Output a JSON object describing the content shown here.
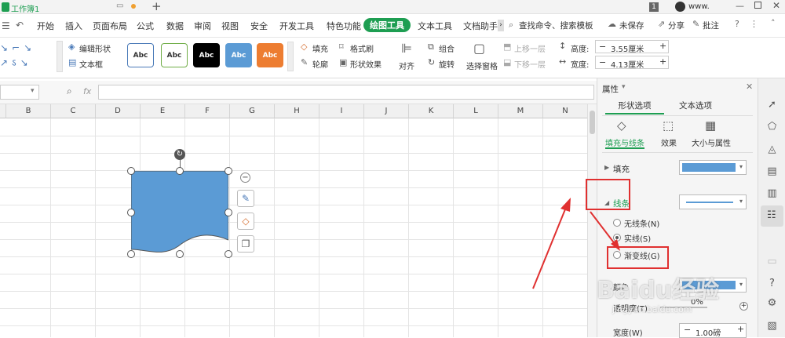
{
  "titlebar": {
    "doc_title": "工作簿1",
    "page_badge": "1",
    "account": "www."
  },
  "menu": {
    "items": [
      "开始",
      "插入",
      "页面布局",
      "公式",
      "数据",
      "审阅",
      "视图",
      "安全",
      "开发工具",
      "特色功能",
      "绘图工具",
      "文本工具",
      "文档助手"
    ],
    "active": "绘图工具",
    "search": "查找命令、搜索模板",
    "unsaved": "未保存",
    "share": "分享",
    "comment": "批注"
  },
  "ribbon": {
    "edit_shape": "编辑形状",
    "textbox": "文本框",
    "styles": [
      "Abc",
      "Abc",
      "Abc",
      "Abc",
      "Abc"
    ],
    "fill": "填充",
    "format_brush": "格式刷",
    "outline": "轮廓",
    "shape_effect": "形状效果",
    "align": "对齐",
    "group": "组合",
    "rotate": "旋转",
    "selection_pane": "选择窗格",
    "bring_forward": "上移一层",
    "send_backward": "下移一层",
    "height_label": "高度:",
    "height_value": "3.55厘米",
    "width_label": "宽度:",
    "width_value": "4.13厘米"
  },
  "formula": {
    "fx": "fx"
  },
  "grid": {
    "columns": [
      "B",
      "C",
      "D",
      "E",
      "F",
      "G",
      "H",
      "I",
      "J",
      "K",
      "L",
      "M",
      "N"
    ]
  },
  "panel": {
    "title": "属性",
    "tabs": [
      "形状选项",
      "文本选项"
    ],
    "subtabs": [
      "填充与线条",
      "效果",
      "大小与属性"
    ],
    "fill_label": "填充",
    "line_label": "线条",
    "options": [
      "无线条(N)",
      "实线(S)",
      "渐变线(G)"
    ],
    "selected_option": "实线(S)",
    "color_label": "颜色",
    "transparency_label": "透明度(T)",
    "transparency_value": "0%",
    "width_label": "宽度(W)",
    "width_value": "1.00磅"
  },
  "watermark": {
    "text": "Baidu经验",
    "url": "jingyan.baidu.com"
  },
  "colors": {
    "accent_green": "#1e9e52",
    "shape_fill": "#5b9bd5",
    "annotation_red": "#e03030"
  }
}
